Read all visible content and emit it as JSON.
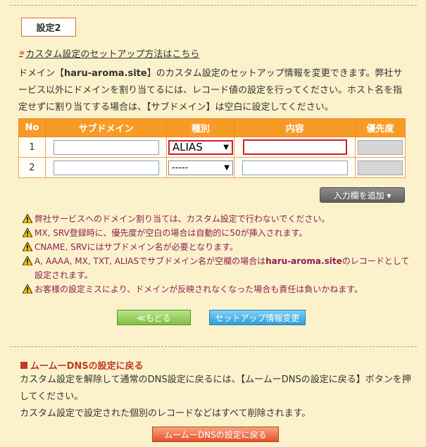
{
  "section": {
    "title": "設定2"
  },
  "help_link": {
    "arrow": "»",
    "label": "カスタム設定のセットアップ方法はこちら"
  },
  "intro": {
    "p1": "ドメイン【",
    "domain": "haru-aroma.site",
    "p2": "】のカスタム設定のセットアップ情報を変更できます。弊社サービス以外にドメインを割り当てるには、レコード値の設定を行ってください。ホスト名を指定せずに割り当てする場合は、【サブドメイン】は空白に設定してください。"
  },
  "table": {
    "headers": [
      "No",
      "サブドメイン",
      "種別",
      "内容",
      "優先度"
    ],
    "rows": [
      {
        "no": "1",
        "subdomain": "",
        "type": "ALIAS",
        "content": "",
        "priority": ""
      },
      {
        "no": "2",
        "subdomain": "",
        "type": "-----",
        "content": "",
        "priority": ""
      }
    ]
  },
  "add_button": {
    "label": "入力欄を追加 ▾"
  },
  "notes": [
    {
      "text": "弊社サービスへのドメイン割り当ては、カスタム設定で行わないでください。"
    },
    {
      "text": "MX, SRV登録時に、優先度が空白の場合は自動的に50が挿入されます。"
    },
    {
      "text": "CNAME, SRVにはサブドメイン名が必要となります。"
    },
    {
      "pre": "A, AAAA, MX, TXT, ALIASでサブドメイン名が空欄の場合は",
      "domain": "haru-aroma.site",
      "post": "のレコードとして設定されます。"
    },
    {
      "text": "お客様の設定ミスにより、ドメインが反映されなくなった場合も責任は負いかねます。"
    }
  ],
  "buttons": {
    "back": "≪もどる",
    "change": "セットアップ情報変更",
    "dns": "ムームーDNSの設定に戻る"
  },
  "dns_section": {
    "title": "ムームーDNSの設定に戻る",
    "line1": "カスタム設定を解除して通常のDNS設定に戻るには、【ムームーDNSの設定に戻る】ボタンを押してください。",
    "line2": "カスタム設定で設定された個別のレコードなどはすべて削除されます。"
  },
  "colors": {
    "header": "#f79b27",
    "warning_text": "#8c1f52",
    "accent": "#d9502c"
  }
}
